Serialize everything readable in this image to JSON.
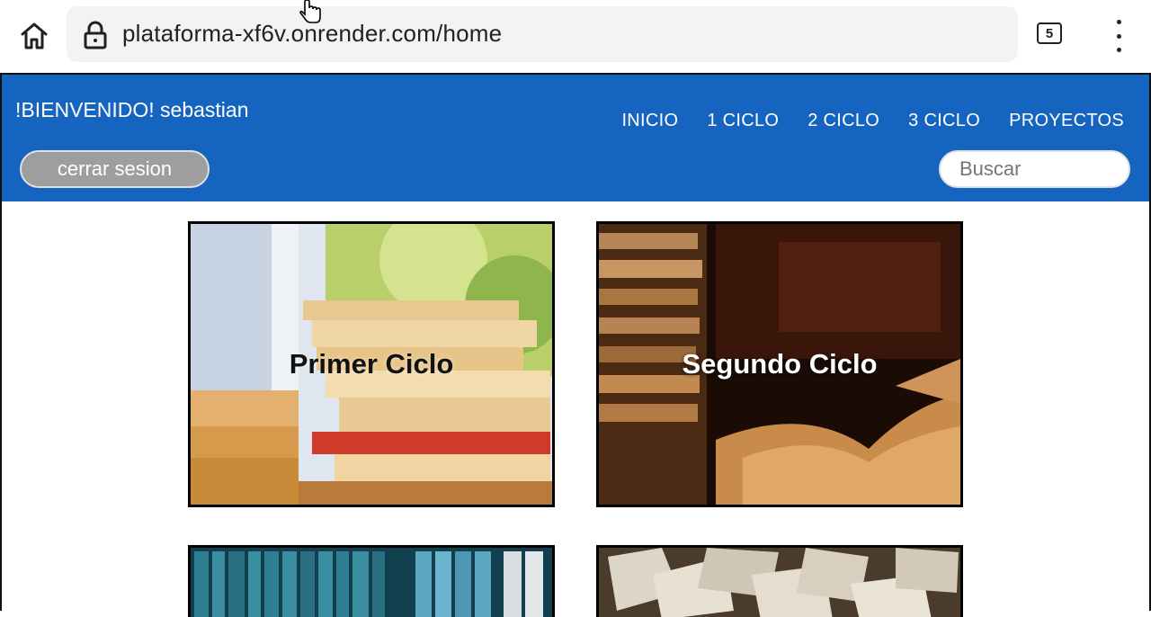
{
  "browser": {
    "url": "plataforma-xf6v.onrender.com/home",
    "tab_count": "5"
  },
  "header": {
    "welcome": "!BIENVENIDO! sebastian",
    "nav": [
      "INICIO",
      "1 CICLO",
      "2 CICLO",
      "3 CICLO",
      "PROYECTOS"
    ],
    "logout_label": "cerrar sesion",
    "search_placeholder": "Buscar",
    "background_color": "#1565c0"
  },
  "cards": [
    {
      "title": "Primer Ciclo"
    },
    {
      "title": "Segundo Ciclo"
    },
    {
      "title": ""
    },
    {
      "title": ""
    }
  ]
}
